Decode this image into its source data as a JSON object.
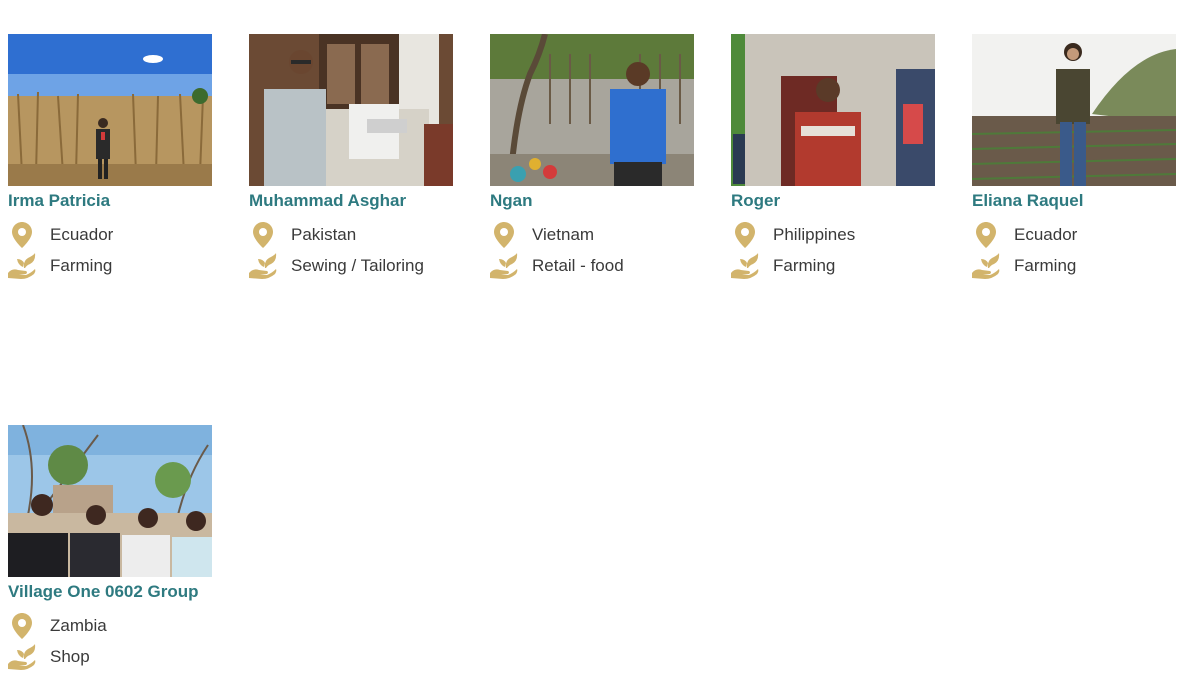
{
  "colors": {
    "name": "#2e7a80",
    "icon": "#d2b46c",
    "text": "#3a3a3a"
  },
  "icons": {
    "location": "map-pin-icon",
    "sector": "hand-sprout-icon"
  },
  "loans": [
    {
      "name": "Irma Patricia",
      "country": "Ecuador",
      "sector": "Farming"
    },
    {
      "name": "Muhammad Asghar",
      "country": "Pakistan",
      "sector": "Sewing / Tailoring"
    },
    {
      "name": "Ngan",
      "country": "Vietnam",
      "sector": "Retail - food"
    },
    {
      "name": "Roger",
      "country": "Philippines",
      "sector": "Farming"
    },
    {
      "name": "Eliana Raquel",
      "country": "Ecuador",
      "sector": "Farming"
    },
    {
      "name": "Village One 0602 Group",
      "country": "Zambia",
      "sector": "Shop"
    }
  ]
}
